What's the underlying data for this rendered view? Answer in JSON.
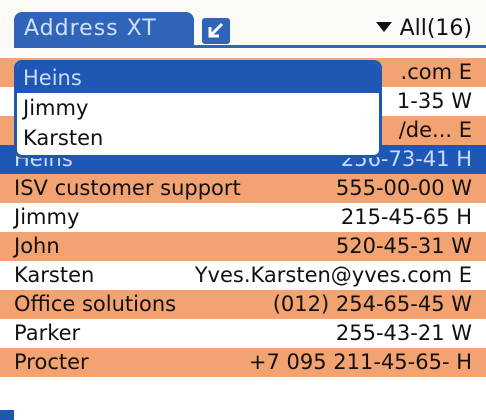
{
  "app": {
    "title": "Address XT",
    "category": "All(16)"
  },
  "popup": {
    "items": [
      "Heins",
      "Jimmy",
      "Karsten"
    ],
    "highlighted_index": 0
  },
  "list": {
    "rows": [
      {
        "name": "",
        "value": ".com E",
        "style": "orange"
      },
      {
        "name": "",
        "value": "1-35 W",
        "style": "white"
      },
      {
        "name": "",
        "value": "/de... E",
        "style": "orange"
      },
      {
        "name": "Heins",
        "value": "256-73-41 H",
        "style": "sel"
      },
      {
        "name": "ISV customer support",
        "value": "555-00-00 W",
        "style": "orange"
      },
      {
        "name": "Jimmy",
        "value": "215-45-65 H",
        "style": "white"
      },
      {
        "name": "John",
        "value": "520-45-31 W",
        "style": "orange"
      },
      {
        "name": "Karsten",
        "value": "Yves.Karsten@yves.com E",
        "style": "white"
      },
      {
        "name": "Office solutions",
        "value": "(012) 254-65-45 W",
        "style": "orange"
      },
      {
        "name": "Parker",
        "value": "255-43-21 W",
        "style": "white"
      },
      {
        "name": "Procter",
        "value": "+7 095 211-45-65- H",
        "style": "orange"
      }
    ]
  }
}
